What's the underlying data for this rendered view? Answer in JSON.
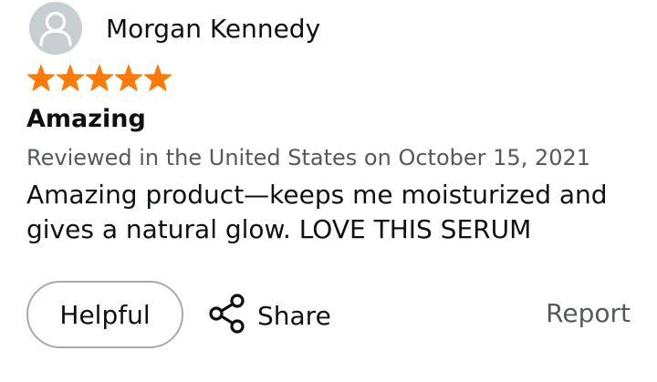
{
  "review": {
    "reviewer": {
      "name": "Morgan Kennedy",
      "avatar_icon": "person-avatar-icon"
    },
    "rating": {
      "stars": 5,
      "max_stars": 5,
      "star_color": "#ff7a00"
    },
    "title": "Amazing",
    "meta": "Reviewed in the United States on October 15, 2021",
    "body": "Amazing product—keeps me moisturized and gives a natural glow. LOVE THIS SERUM"
  },
  "actions": {
    "helpful_label": "Helpful",
    "share_label": "Share",
    "share_icon": "share-icon",
    "report_label": "Report"
  }
}
